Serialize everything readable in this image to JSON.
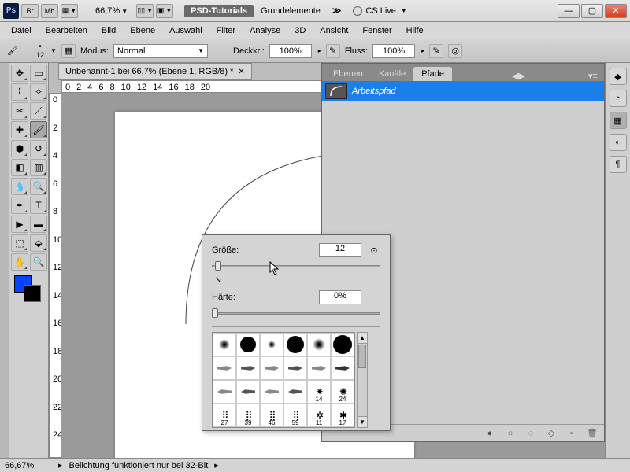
{
  "titlebar": {
    "ps": "Ps",
    "br": "Br",
    "mb": "Mb",
    "zoom": "66,7%",
    "psd_tutorials": "PSD-Tutorials",
    "grundelemente": "Grundelemente",
    "cslive": "CS Live"
  },
  "menu": [
    "Datei",
    "Bearbeiten",
    "Bild",
    "Ebene",
    "Auswahl",
    "Filter",
    "Analyse",
    "3D",
    "Ansicht",
    "Fenster",
    "Hilfe"
  ],
  "options": {
    "size": "12",
    "modus_label": "Modus:",
    "modus_value": "Normal",
    "deckkr_label": "Deckkr.:",
    "deckkr_value": "100%",
    "fluss_label": "Fluss:",
    "fluss_value": "100%"
  },
  "doc_tab": "Unbenannt-1 bei 66,7% (Ebene 1, RGB/8) *",
  "ruler_h": [
    "0",
    "2",
    "4",
    "6",
    "8",
    "10",
    "12",
    "14",
    "16",
    "18",
    "20"
  ],
  "ruler_v": [
    "0",
    "2",
    "4",
    "6",
    "8",
    "10",
    "12",
    "14",
    "16",
    "18",
    "20",
    "22",
    "24"
  ],
  "panel": {
    "tabs": [
      "Ebenen",
      "Kanäle",
      "Pfade"
    ],
    "active_tab": 2,
    "path_name": "Arbeitspfad"
  },
  "brush_popup": {
    "size_label": "Größe:",
    "size_value": "12",
    "hardness_label": "Härte:",
    "hardness_value": "0%",
    "preset_numbers_row3": [
      "",
      "",
      "",
      "",
      "14",
      "24"
    ],
    "preset_numbers_row4": [
      "27",
      "39",
      "46",
      "59",
      "11",
      "17"
    ]
  },
  "status": {
    "zoom": "66,67%",
    "msg": "Belichtung funktioniert nur bei 32-Bit"
  },
  "colors": {
    "fg": "#0044ff",
    "bg": "#000000"
  }
}
